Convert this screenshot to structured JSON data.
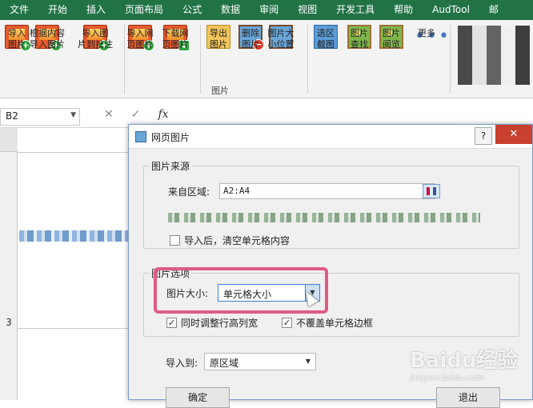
{
  "ribbon_tabs": [
    "文件",
    "开始",
    "插入",
    "页面布局",
    "公式",
    "数据",
    "审阅",
    "视图",
    "开发工具",
    "帮助",
    "AudTool",
    "邮"
  ],
  "active_tab_index": -1,
  "ribbon_buttons": [
    {
      "label": "导入\n图片",
      "icon": "import-picture-icon"
    },
    {
      "label": "根据内容\n导入图片",
      "icon": "import-by-content-icon"
    },
    {
      "label": "导入图\n片到批注",
      "icon": "import-to-comment-icon"
    },
    {
      "label": "导入网\n页图片",
      "icon": "import-web-picture-icon"
    },
    {
      "label": "下载网\n页图片",
      "icon": "download-web-picture-icon"
    },
    {
      "label": "导出\n图片",
      "icon": "export-picture-icon"
    },
    {
      "label": "删除\n图片",
      "icon": "delete-picture-icon"
    },
    {
      "label": "图片大\n小位置",
      "icon": "picture-size-position-icon"
    },
    {
      "label": "选区\n截图",
      "icon": "selection-screenshot-icon"
    },
    {
      "label": "图片\n查找",
      "icon": "picture-find-icon"
    },
    {
      "label": "图片\n阅览",
      "icon": "picture-browse-icon"
    },
    {
      "label": "更多",
      "icon": "more-icon"
    }
  ],
  "ribbon_group_label": "图片",
  "formula_bar": {
    "name_box": "B2",
    "cancel": "✕",
    "enter": "✓",
    "fx": "fx"
  },
  "row_numbers": [
    "3"
  ],
  "dialog": {
    "title": "网页图片",
    "help": "?",
    "close": "✕",
    "source_group": {
      "legend": "图片来源",
      "range_label": "来自区域:",
      "range_value": "A2:A4",
      "clear_checkbox_label": "导入后，清空单元格内容",
      "clear_checked": false
    },
    "options_group": {
      "legend": "图片选项",
      "size_label": "图片大小:",
      "size_value": "单元格大小",
      "adjust_label": "同时调整行高列宽",
      "adjust_checked": true,
      "no_cover_label": "不覆盖单元格边框",
      "no_cover_checked": true
    },
    "import_to_label": "导入到:",
    "import_to_value": "原区域",
    "ok_button": "确定",
    "exit_button": "退出"
  },
  "colors": {
    "excel_green": "#217346",
    "highlight": "#e05a86",
    "close_red": "#c9402f"
  },
  "watermark": {
    "text": "Baidu经验",
    "sub": "jingyan.baidu.com"
  }
}
